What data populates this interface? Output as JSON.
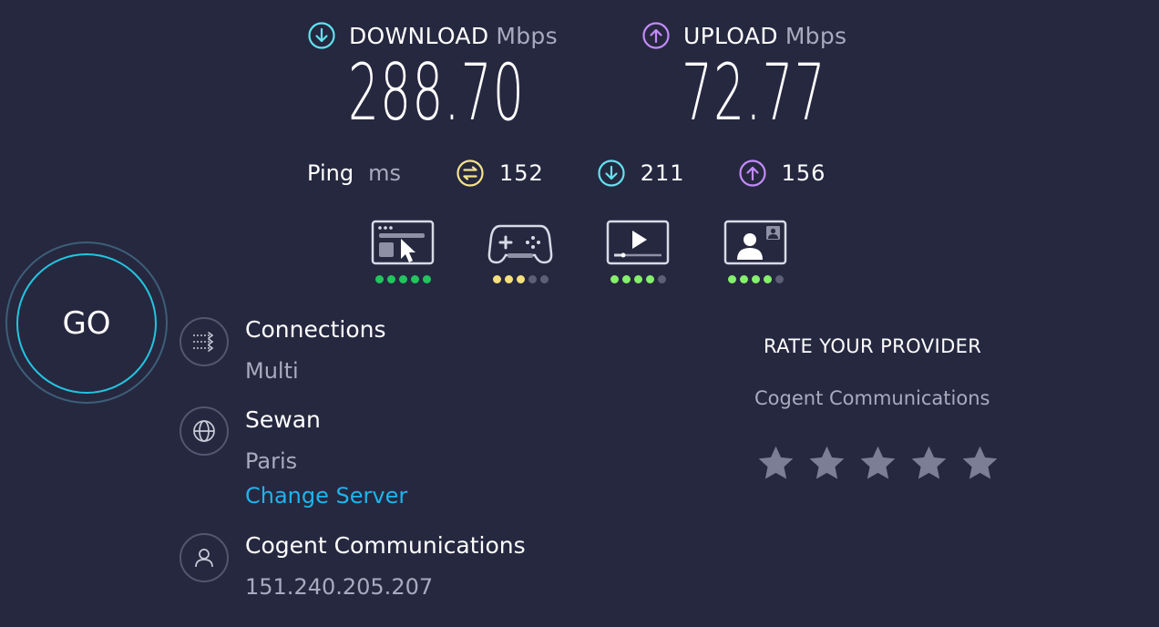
{
  "download": {
    "label": "DOWNLOAD",
    "unit": "Mbps",
    "value": "288.70",
    "color": "#5fe3ee"
  },
  "upload": {
    "label": "UPLOAD",
    "unit": "Mbps",
    "value": "72.77",
    "color": "#c28bf8"
  },
  "ping": {
    "label": "Ping",
    "unit": "ms",
    "idle": "152",
    "download": "211",
    "upload": "156",
    "idle_color": "#f4e38a"
  },
  "quality": [
    {
      "name": "web-browsing",
      "icon": "browser-cursor-icon",
      "rating": 5,
      "max": 5,
      "color": "#22c55e"
    },
    {
      "name": "gaming",
      "icon": "gamepad-icon",
      "rating": 3,
      "max": 5,
      "color": "#f5e07a"
    },
    {
      "name": "streaming",
      "icon": "video-play-icon",
      "rating": 4,
      "max": 5,
      "color": "#86ef6b"
    },
    {
      "name": "video-chat",
      "icon": "video-call-icon",
      "rating": 4,
      "max": 5,
      "color": "#86ef6b"
    }
  ],
  "go_button": "GO",
  "connections": {
    "title": "Connections",
    "value": "Multi"
  },
  "server": {
    "name": "Sewan",
    "location": "Paris",
    "change_label": "Change Server"
  },
  "provider": {
    "name": "Cogent Communications",
    "ip": "151.240.205.207"
  },
  "rate": {
    "title": "RATE YOUR PROVIDER",
    "isp": "Cogent Communications",
    "stars": 5
  }
}
